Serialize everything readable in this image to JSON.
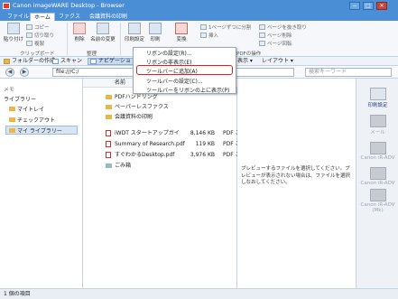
{
  "window": {
    "title": "Canon imageWARE Desktop - Browser",
    "min": "−",
    "max": "□",
    "close": "✕"
  },
  "tabs": [
    "ファイル",
    "ホーム",
    "ファクス",
    "会議資料の印刷"
  ],
  "ribbon": {
    "copy": "コピー",
    "cut": "切り取り",
    "dup": "複製",
    "paste": "貼り付け",
    "delete": "削除",
    "rename": "名前の変更",
    "print_settings": "印刷設定",
    "print": "印刷",
    "convert": "変換",
    "split": "1ページずつに分割",
    "insert": "挿入",
    "pdf1": "ページを抜き取り",
    "pdf2": "ページ削除",
    "pdf3": "ページ回転",
    "grp_clipboard": "クリップボード",
    "grp_organize": "整理",
    "grp_pdf": "PDFの操作"
  },
  "toolbar": {
    "new_folder": "フォルダーの作成",
    "scan": "スキャン",
    "nav": "ナビゲーショ",
    "view": "表示 ▾",
    "layout": "レイアウト ▾"
  },
  "navbar": {
    "path": "file:///C:/",
    "search_placeholder": "検索キーワード",
    "back": "◀",
    "fwd": "▶"
  },
  "left": {
    "memo": "メモ",
    "library": "ライブラリー",
    "items": [
      "マイトレイ",
      "チェックアウト",
      "マイ ライブラリー"
    ]
  },
  "filelist": {
    "col_name": "名前",
    "col_type": "種類",
    "files": [
      {
        "name": "PDFハンドリング",
        "size": "",
        "type": ""
      },
      {
        "name": "ペーパーレスファクス",
        "size": "",
        "type": ""
      },
      {
        "name": "会議資料の印刷",
        "size": "",
        "type": ""
      },
      {
        "name": "iWDT スタートアップガイ",
        "size": "8,146 KB",
        "type": "PDF こ"
      },
      {
        "name": "Summary of Research.pdf",
        "size": "119 KB",
        "type": "PDF こ"
      },
      {
        "name": "すぐわかるDesktop.pdf",
        "size": "3,976 KB",
        "type": "PDF こ"
      },
      {
        "name": "ごみ箱",
        "size": "",
        "type": ""
      }
    ]
  },
  "preview": {
    "text": "プレビューするファイルを選択してください。プレビューが表示されない場合は、ファイルを選択しなおしてください。"
  },
  "rightpanel": [
    "印刷設定",
    "メール",
    "Canon iR-ADV",
    "Canon iR-ADV",
    "Canon iR-ADV (Mk)"
  ],
  "status": "1 個の項目",
  "menu": {
    "items": [
      "リボンの設定(R)...",
      "リボンの非表示(E)",
      "ツールバーに追加(A)",
      "ツールバーの設定(C)...",
      "ツールバーをリボンの上に表示(P)"
    ],
    "highlighted_index": 2
  }
}
